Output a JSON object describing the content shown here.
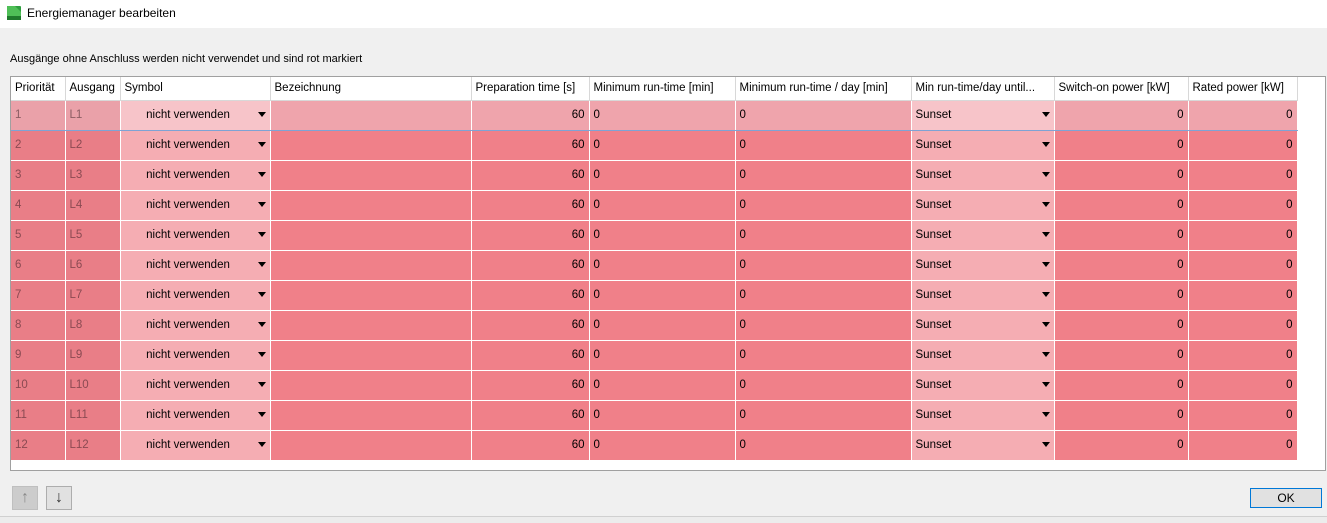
{
  "window": {
    "title": "Energiemanager bearbeiten",
    "icon": "app-icon-green"
  },
  "info_text": "Ausgänge ohne Anschluss werden nicht verwendet und sind rot markiert",
  "colors": {
    "row_red": "#f08089",
    "row_selected": "#efa4ac",
    "combo_bg": "#f5adb3",
    "accent": "#0078d7"
  },
  "columns": [
    "Priorität",
    "Ausgang",
    "Symbol",
    "Bezeichnung",
    "Preparation time [s]",
    "Minimum run-time [min]",
    "Minimum run-time / day [min]",
    "Min run-time/day until...",
    "Switch-on power [kW]",
    "Rated power [kW]"
  ],
  "rows": [
    {
      "prio": "1",
      "out": "L1",
      "symbol": "nicht verwenden",
      "name": "",
      "prep": "60",
      "minrun": "0",
      "minday": "0",
      "until": "Sunset",
      "switchon": "0",
      "rated": "0"
    },
    {
      "prio": "2",
      "out": "L2",
      "symbol": "nicht verwenden",
      "name": "",
      "prep": "60",
      "minrun": "0",
      "minday": "0",
      "until": "Sunset",
      "switchon": "0",
      "rated": "0"
    },
    {
      "prio": "3",
      "out": "L3",
      "symbol": "nicht verwenden",
      "name": "",
      "prep": "60",
      "minrun": "0",
      "minday": "0",
      "until": "Sunset",
      "switchon": "0",
      "rated": "0"
    },
    {
      "prio": "4",
      "out": "L4",
      "symbol": "nicht verwenden",
      "name": "",
      "prep": "60",
      "minrun": "0",
      "minday": "0",
      "until": "Sunset",
      "switchon": "0",
      "rated": "0"
    },
    {
      "prio": "5",
      "out": "L5",
      "symbol": "nicht verwenden",
      "name": "",
      "prep": "60",
      "minrun": "0",
      "minday": "0",
      "until": "Sunset",
      "switchon": "0",
      "rated": "0"
    },
    {
      "prio": "6",
      "out": "L6",
      "symbol": "nicht verwenden",
      "name": "",
      "prep": "60",
      "minrun": "0",
      "minday": "0",
      "until": "Sunset",
      "switchon": "0",
      "rated": "0"
    },
    {
      "prio": "7",
      "out": "L7",
      "symbol": "nicht verwenden",
      "name": "",
      "prep": "60",
      "minrun": "0",
      "minday": "0",
      "until": "Sunset",
      "switchon": "0",
      "rated": "0"
    },
    {
      "prio": "8",
      "out": "L8",
      "symbol": "nicht verwenden",
      "name": "",
      "prep": "60",
      "minrun": "0",
      "minday": "0",
      "until": "Sunset",
      "switchon": "0",
      "rated": "0"
    },
    {
      "prio": "9",
      "out": "L9",
      "symbol": "nicht verwenden",
      "name": "",
      "prep": "60",
      "minrun": "0",
      "minday": "0",
      "until": "Sunset",
      "switchon": "0",
      "rated": "0"
    },
    {
      "prio": "10",
      "out": "L10",
      "symbol": "nicht verwenden",
      "name": "",
      "prep": "60",
      "minrun": "0",
      "minday": "0",
      "until": "Sunset",
      "switchon": "0",
      "rated": "0"
    },
    {
      "prio": "11",
      "out": "L11",
      "symbol": "nicht verwenden",
      "name": "",
      "prep": "60",
      "minrun": "0",
      "minday": "0",
      "until": "Sunset",
      "switchon": "0",
      "rated": "0"
    },
    {
      "prio": "12",
      "out": "L12",
      "symbol": "nicht verwenden",
      "name": "",
      "prep": "60",
      "minrun": "0",
      "minday": "0",
      "until": "Sunset",
      "switchon": "0",
      "rated": "0"
    }
  ],
  "buttons": {
    "up_icon": "arrow-up-icon",
    "down_icon": "arrow-down-icon",
    "up_glyph": "↑",
    "down_glyph": "↓",
    "ok": "OK"
  }
}
